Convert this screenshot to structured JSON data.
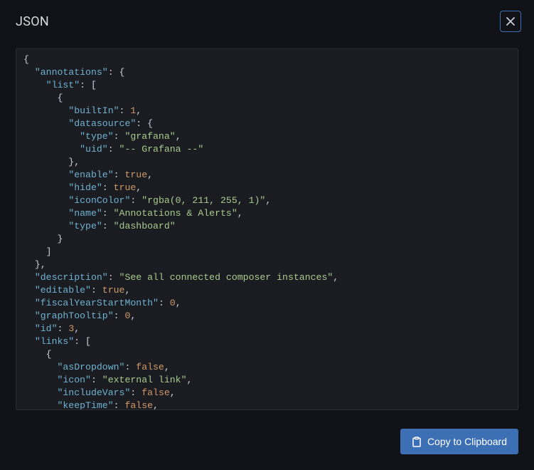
{
  "header": {
    "title": "JSON"
  },
  "code": {
    "lines": [
      [
        [
          "p",
          "{"
        ]
      ],
      [
        [
          "p",
          "  "
        ],
        [
          "k",
          "\"annotations\""
        ],
        [
          "p",
          ": {"
        ]
      ],
      [
        [
          "p",
          "    "
        ],
        [
          "k",
          "\"list\""
        ],
        [
          "p",
          ": ["
        ]
      ],
      [
        [
          "p",
          "      {"
        ]
      ],
      [
        [
          "p",
          "        "
        ],
        [
          "k",
          "\"builtIn\""
        ],
        [
          "p",
          ": "
        ],
        [
          "n",
          "1"
        ],
        [
          "p",
          ","
        ]
      ],
      [
        [
          "p",
          "        "
        ],
        [
          "k",
          "\"datasource\""
        ],
        [
          "p",
          ": {"
        ]
      ],
      [
        [
          "p",
          "          "
        ],
        [
          "k",
          "\"type\""
        ],
        [
          "p",
          ": "
        ],
        [
          "s",
          "\"grafana\""
        ],
        [
          "p",
          ","
        ]
      ],
      [
        [
          "p",
          "          "
        ],
        [
          "k",
          "\"uid\""
        ],
        [
          "p",
          ": "
        ],
        [
          "s",
          "\"-- Grafana --\""
        ]
      ],
      [
        [
          "p",
          "        },"
        ]
      ],
      [
        [
          "p",
          "        "
        ],
        [
          "k",
          "\"enable\""
        ],
        [
          "p",
          ": "
        ],
        [
          "b",
          "true"
        ],
        [
          "p",
          ","
        ]
      ],
      [
        [
          "p",
          "        "
        ],
        [
          "k",
          "\"hide\""
        ],
        [
          "p",
          ": "
        ],
        [
          "b",
          "true"
        ],
        [
          "p",
          ","
        ]
      ],
      [
        [
          "p",
          "        "
        ],
        [
          "k",
          "\"iconColor\""
        ],
        [
          "p",
          ": "
        ],
        [
          "s",
          "\"rgba(0, 211, 255, 1)\""
        ],
        [
          "p",
          ","
        ]
      ],
      [
        [
          "p",
          "        "
        ],
        [
          "k",
          "\"name\""
        ],
        [
          "p",
          ": "
        ],
        [
          "s",
          "\"Annotations & Alerts\""
        ],
        [
          "p",
          ","
        ]
      ],
      [
        [
          "p",
          "        "
        ],
        [
          "k",
          "\"type\""
        ],
        [
          "p",
          ": "
        ],
        [
          "s",
          "\"dashboard\""
        ]
      ],
      [
        [
          "p",
          "      }"
        ]
      ],
      [
        [
          "p",
          "    ]"
        ]
      ],
      [
        [
          "p",
          "  },"
        ]
      ],
      [
        [
          "p",
          "  "
        ],
        [
          "k",
          "\"description\""
        ],
        [
          "p",
          ": "
        ],
        [
          "s",
          "\"See all connected composer instances\""
        ],
        [
          "p",
          ","
        ]
      ],
      [
        [
          "p",
          "  "
        ],
        [
          "k",
          "\"editable\""
        ],
        [
          "p",
          ": "
        ],
        [
          "b",
          "true"
        ],
        [
          "p",
          ","
        ]
      ],
      [
        [
          "p",
          "  "
        ],
        [
          "k",
          "\"fiscalYearStartMonth\""
        ],
        [
          "p",
          ": "
        ],
        [
          "n",
          "0"
        ],
        [
          "p",
          ","
        ]
      ],
      [
        [
          "p",
          "  "
        ],
        [
          "k",
          "\"graphTooltip\""
        ],
        [
          "p",
          ": "
        ],
        [
          "n",
          "0"
        ],
        [
          "p",
          ","
        ]
      ],
      [
        [
          "p",
          "  "
        ],
        [
          "k",
          "\"id\""
        ],
        [
          "p",
          ": "
        ],
        [
          "n",
          "3"
        ],
        [
          "p",
          ","
        ]
      ],
      [
        [
          "p",
          "  "
        ],
        [
          "k",
          "\"links\""
        ],
        [
          "p",
          ": ["
        ]
      ],
      [
        [
          "p",
          "    {"
        ]
      ],
      [
        [
          "p",
          "      "
        ],
        [
          "k",
          "\"asDropdown\""
        ],
        [
          "p",
          ": "
        ],
        [
          "b",
          "false"
        ],
        [
          "p",
          ","
        ]
      ],
      [
        [
          "p",
          "      "
        ],
        [
          "k",
          "\"icon\""
        ],
        [
          "p",
          ": "
        ],
        [
          "s",
          "\"external link\""
        ],
        [
          "p",
          ","
        ]
      ],
      [
        [
          "p",
          "      "
        ],
        [
          "k",
          "\"includeVars\""
        ],
        [
          "p",
          ": "
        ],
        [
          "b",
          "false"
        ],
        [
          "p",
          ","
        ]
      ],
      [
        [
          "p",
          "      "
        ],
        [
          "k",
          "\"keepTime\""
        ],
        [
          "p",
          ": "
        ],
        [
          "b",
          "false"
        ],
        [
          "p",
          ","
        ]
      ]
    ]
  },
  "footer": {
    "copy_label": "Copy to Clipboard"
  }
}
